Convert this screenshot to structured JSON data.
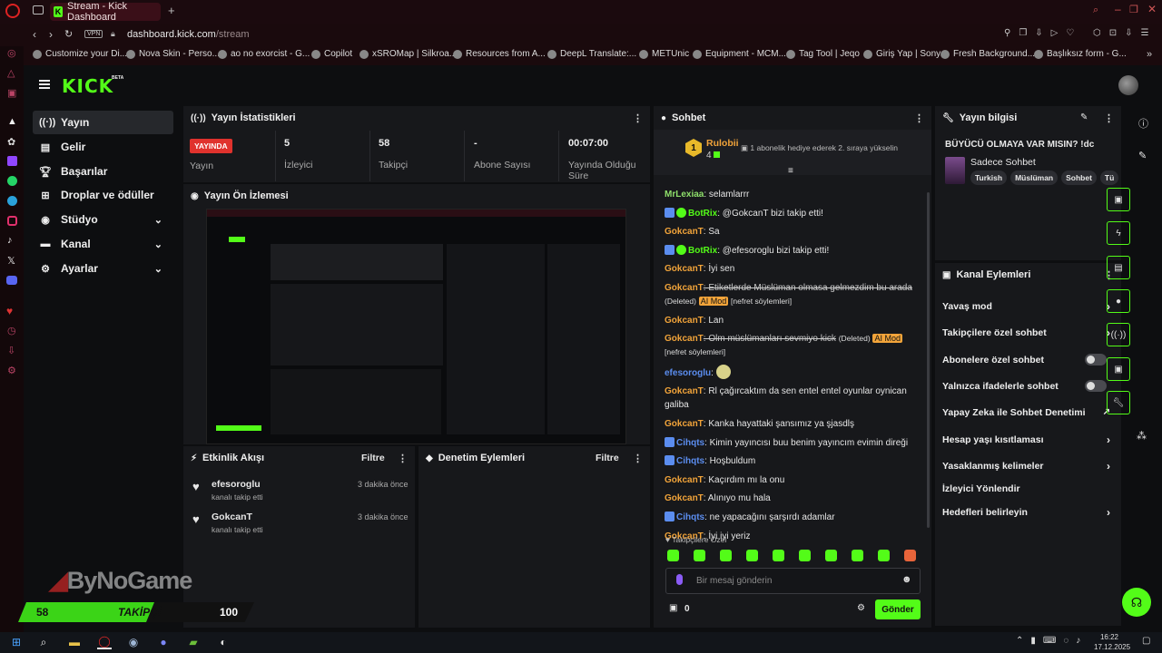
{
  "browser": {
    "tab_title": "Stream - Kick Dashboard",
    "url_host": "dashboard.kick.com",
    "url_path": "/stream",
    "vpn_label": "VPN",
    "bookmarks": [
      "Customize your Di...",
      "Nova Skin - Perso...",
      "ao no exorcist - G...",
      "Copilot",
      "xSROMap | Silkroa...",
      "Resources from A...",
      "DeepL Translate:...",
      "METUnic",
      "Equipment - MCM...",
      "Tag Tool | Jeqo",
      "Giriş Yap | Sony",
      "Fresh Background...",
      "Başlıksız form - G..."
    ]
  },
  "header": {
    "logo": "KICK",
    "beta": "BETA"
  },
  "sidebar": {
    "items": [
      {
        "label": "Yayın",
        "icon": "broadcast-icon"
      },
      {
        "label": "Gelir",
        "icon": "money-icon"
      },
      {
        "label": "Başarılar",
        "icon": "trophy-icon"
      },
      {
        "label": "Droplar ve ödüller",
        "icon": "gift-icon"
      },
      {
        "label": "Stüdyo",
        "icon": "studio-icon"
      },
      {
        "label": "Kanal",
        "icon": "channel-icon"
      },
      {
        "label": "Ayarlar",
        "icon": "gear-icon"
      }
    ]
  },
  "stats": {
    "title": "Yayın İstatistikleri",
    "live_badge": "YAYINDA",
    "items": [
      {
        "value": "",
        "label": "Yayın"
      },
      {
        "value": "5",
        "label": "İzleyici"
      },
      {
        "value": "58",
        "label": "Takipçi"
      },
      {
        "value": "-",
        "label": "Abone Sayısı"
      },
      {
        "value": "00:07:00",
        "label": "Yayında Olduğu Süre"
      }
    ]
  },
  "preview": {
    "title": "Yayın Ön İzlemesi"
  },
  "activity": {
    "title": "Etkinlik Akışı",
    "filter": "Filtre",
    "events": [
      {
        "user": "efesoroglu",
        "text": "kanalı takip etti",
        "time": "3 dakika önce"
      },
      {
        "user": "GokcanT",
        "text": "kanalı takip etti",
        "time": "3 dakika önce"
      }
    ]
  },
  "moderation": {
    "title": "Denetim Eylemleri",
    "filter": "Filtre"
  },
  "chat": {
    "title": "Sohbet",
    "gifter_name": "Rulobii",
    "gifter_rank": "1",
    "gifter_count": "4",
    "gift_message": "1 abonelik hediye ederek 2. sıraya yükselin",
    "messages": [
      {
        "user": "MrLexiaa",
        "text": ": selamlarrr"
      },
      {
        "user": "BotRix",
        "text": ": @GokcanT bizi takip etti!"
      },
      {
        "user": "GokcanT",
        "text": ": Sa"
      },
      {
        "user": "BotRix",
        "text": ": @efesoroglu bizi takip etti!"
      },
      {
        "user": "GokcanT",
        "text": ": İyi sen"
      },
      {
        "user": "GokcanT",
        "text": ": Etiketlerde Müslüman olmasa gelmezdim bu arada",
        "deleted": "(Deleted)",
        "aimod": "AI Mod",
        "reason": "[nefret söylemleri]"
      },
      {
        "user": "GokcanT",
        "text": ": Lan"
      },
      {
        "user": "GokcanT",
        "text": ": Olm müslümanları sevmiyo kick",
        "deleted": "(Deleted)",
        "aimod": "AI Mod",
        "reason": "[nefret söylemleri]"
      },
      {
        "user": "efesoroglu",
        "text": ":"
      },
      {
        "user": "GokcanT",
        "text": ": Rl çağırcaktım da sen entel entel oyunlar oynican galiba"
      },
      {
        "user": "GokcanT",
        "text": ": Kanka hayattaki şansımız ya şjasdlş"
      },
      {
        "user": "Cihqts",
        "text": ": Kimin yayıncısı buu benim yayıncım evimin direği"
      },
      {
        "user": "Cihqts",
        "text": ": Hoşbuldum"
      },
      {
        "user": "GokcanT",
        "text": ": Kaçırdım mı la onu"
      },
      {
        "user": "GokcanT",
        "text": ": Alınıyo mu hala"
      },
      {
        "user": "Cihqts",
        "text": ": ne yapacağını şarşırdı adamlar"
      },
      {
        "user": "GokcanT",
        "text": ": İyi iyi yeriz"
      }
    ],
    "emote_label": "Takipçilere Özel",
    "input_placeholder": "Bir mesaj gönderin",
    "points": "0",
    "send_label": "Gönder"
  },
  "stream_info": {
    "title": "Yayın bilgisi",
    "stream_title": "BÜYÜCÜ OLMAYA VAR MISIN? !dc",
    "category": "Sadece Sohbet",
    "tags": [
      "Turkish",
      "Müslüman",
      "Sohbet",
      "Tü"
    ]
  },
  "channel_actions": {
    "title": "Kanal Eylemleri",
    "items": [
      {
        "label": "Yavaş mod",
        "control": "arrow"
      },
      {
        "label": "Takipçilere özel sohbet",
        "control": "arrow"
      },
      {
        "label": "Abonelere özel sohbet",
        "control": "toggle",
        "on": false
      },
      {
        "label": "Yalnızca ifadelerle sohbet",
        "control": "toggle",
        "on": false
      },
      {
        "label": "Yapay Zeka ile Sohbet Denetimi",
        "control": "external"
      },
      {
        "label": "Hesap yaşı kısıtlaması",
        "control": "arrow"
      },
      {
        "label": "Yasaklanmış kelimeler",
        "control": "arrow"
      },
      {
        "label": "İzleyici Yönlendir",
        "control": "none"
      },
      {
        "label": "Hedefleri belirleyin",
        "control": "arrow"
      }
    ]
  },
  "overlay": {
    "watermark": "ByNoGame",
    "followers": "58",
    "followers_label": "TAKİPÇİ",
    "goal": "100"
  },
  "taskbar": {
    "time": "16:22",
    "date": "17.12.2025"
  }
}
